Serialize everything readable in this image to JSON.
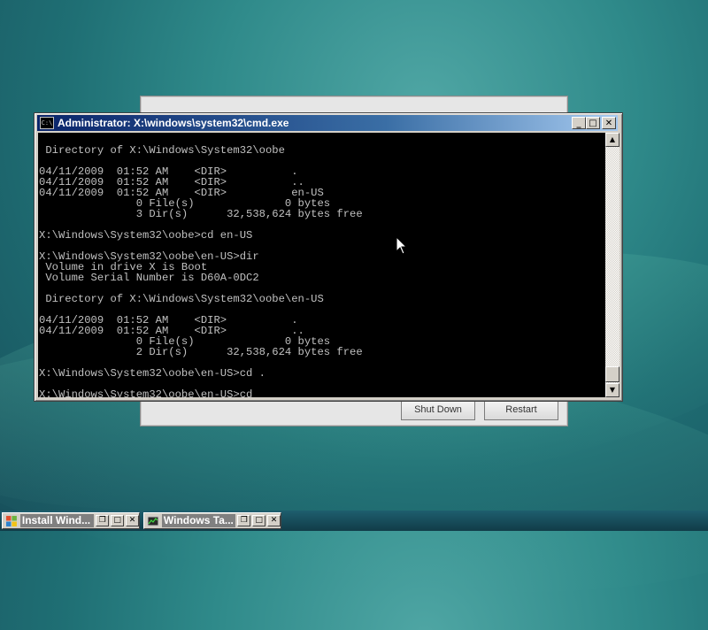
{
  "setup_window": {
    "button_left": "Shut Down",
    "button_right": "Restart"
  },
  "cmd_window": {
    "title": "Administrator: X:\\windows\\system32\\cmd.exe",
    "icon_text": "C:\\",
    "controls": {
      "minimize": "_",
      "maximize": "□",
      "close": "✕"
    },
    "console_lines": [
      "",
      " Directory of X:\\Windows\\System32\\oobe",
      "",
      "04/11/2009  01:52 AM    <DIR>          .",
      "04/11/2009  01:52 AM    <DIR>          ..",
      "04/11/2009  01:52 AM    <DIR>          en-US",
      "               0 File(s)              0 bytes",
      "               3 Dir(s)      32,538,624 bytes free",
      "",
      "X:\\Windows\\System32\\oobe>cd en-US",
      "",
      "X:\\Windows\\System32\\oobe\\en-US>dir",
      " Volume in drive X is Boot",
      " Volume Serial Number is D60A-0DC2",
      "",
      " Directory of X:\\Windows\\System32\\oobe\\en-US",
      "",
      "04/11/2009  01:52 AM    <DIR>          .",
      "04/11/2009  01:52 AM    <DIR>          ..",
      "               0 File(s)              0 bytes",
      "               2 Dir(s)      32,538,624 bytes free",
      "",
      "X:\\Windows\\System32\\oobe\\en-US>cd .",
      "",
      "X:\\Windows\\System32\\oobe\\en-US>cd"
    ]
  },
  "taskbar": {
    "items": [
      {
        "label": "Install Wind...",
        "icon": "windows-setup-icon"
      },
      {
        "label": "Windows Ta...",
        "icon": "task-manager-icon"
      }
    ],
    "controls": {
      "restore": "❐",
      "maximize": "□",
      "close": "✕"
    }
  },
  "colors": {
    "title_bar_start": "#0a246a",
    "title_bar_end": "#a6caf0",
    "console_bg": "#000000",
    "console_fg": "#c0c0c0",
    "desktop": "#2f8a8a"
  }
}
